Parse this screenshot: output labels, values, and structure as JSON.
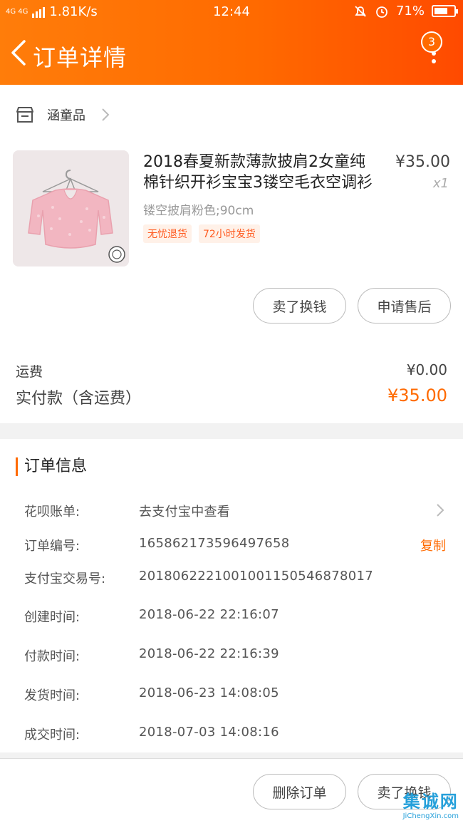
{
  "status": {
    "speed": "1.81K/s",
    "network": "4G 4G",
    "time": "12:44",
    "battery": "71%",
    "battery_level": 0.71
  },
  "nav": {
    "title": "订单详情",
    "badge": "3"
  },
  "shop": {
    "name": "涵童品"
  },
  "product": {
    "title_line1": "2018春夏新款薄款披肩2女童纯",
    "title_line2": "棉针织开衫宝宝3镂空毛衣空调衫",
    "price": "¥35.00",
    "qty": "x1",
    "spec": "镂空披肩粉色;90cm",
    "tags": [
      "无忧退货",
      "72小时发货"
    ]
  },
  "actions": {
    "sell": "卖了换钱",
    "after_sale": "申请售后"
  },
  "fees": {
    "shipping_label": "运费",
    "shipping_value": "¥0.00",
    "paid_label": "实付款（含运费）",
    "paid_value": "¥35.00"
  },
  "order_info": {
    "title": "订单信息",
    "rows": [
      {
        "label": "花呗账单:",
        "value": "去支付宝中查看"
      },
      {
        "label": "订单编号:",
        "value": "165862173596497658",
        "action": "复制"
      },
      {
        "label": "支付宝交易号:",
        "value": "2018062221001001150546878017"
      },
      {
        "label": "创建时间:",
        "value": "2018-06-22 22:16:07"
      },
      {
        "label": "付款时间:",
        "value": "2018-06-22 22:16:39"
      },
      {
        "label": "发货时间:",
        "value": "2018-06-23 14:08:05"
      },
      {
        "label": "成交时间:",
        "value": "2018-07-03 14:08:16"
      }
    ]
  },
  "bottom": {
    "delete": "删除订单",
    "sell": "卖了换钱"
  },
  "watermark": {
    "cn": "集诚网",
    "en": "JiChengXin.com"
  },
  "colors": {
    "accent": "#ff6a00",
    "header_start": "#ff7d0a",
    "header_end": "#ff4a00"
  }
}
